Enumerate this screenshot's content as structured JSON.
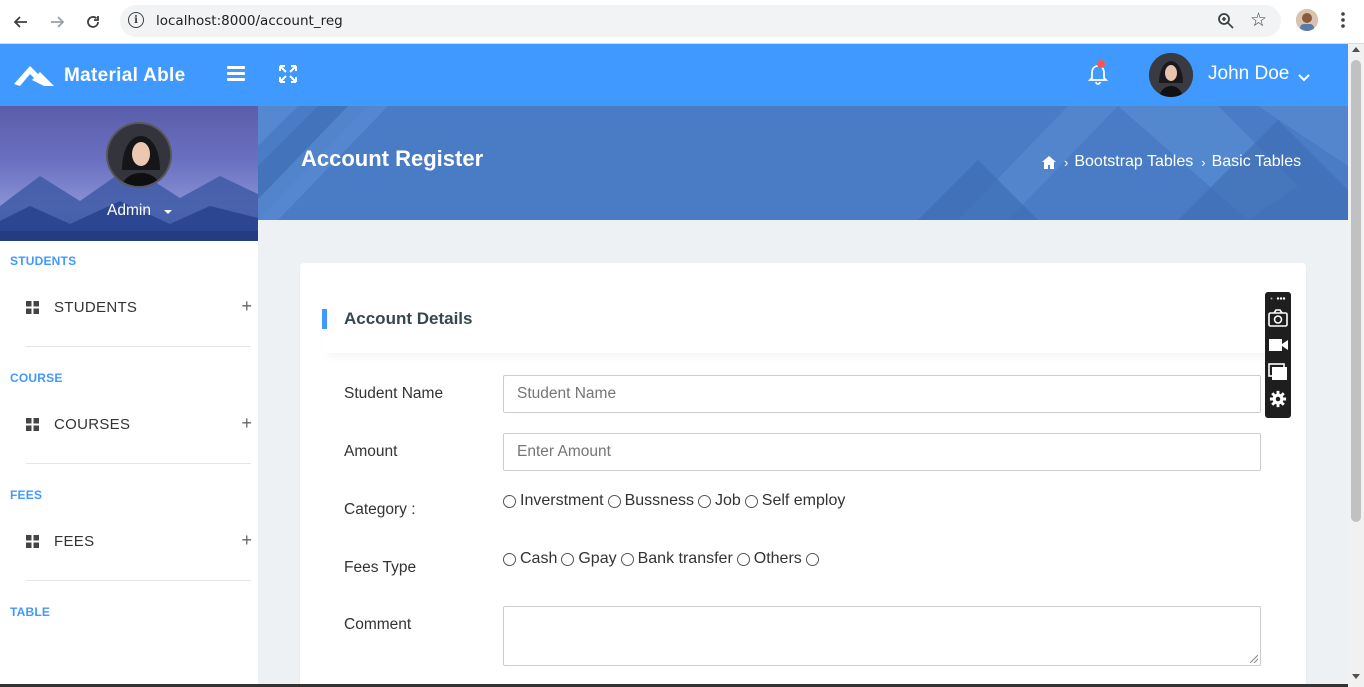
{
  "browser": {
    "url": "localhost:8000/account_reg"
  },
  "header": {
    "app_name": "Material Able",
    "user_name": "John Doe"
  },
  "sidebar": {
    "profile_name": "Admin",
    "sections": [
      {
        "heading": "STUDENTS",
        "item": "STUDENTS"
      },
      {
        "heading": "COURSE",
        "item": "COURSES"
      },
      {
        "heading": "FEES",
        "item": "FEES"
      },
      {
        "heading": "TABLE"
      }
    ]
  },
  "page": {
    "title": "Account Register",
    "breadcrumbs": [
      "Bootstrap Tables",
      "Basic Tables"
    ]
  },
  "form": {
    "card_title": "Account Details",
    "student_name_label": "Student Name",
    "student_name_placeholder": "Student Name",
    "amount_label": "Amount",
    "amount_placeholder": "Enter Amount",
    "category_label": "Category :",
    "category_options": [
      "Inverstment",
      "Bussness",
      "Job",
      "Self employ"
    ],
    "fees_type_label": "Fees Type",
    "fees_type_options": [
      "Cash",
      "Gpay",
      "Bank transfer",
      "Others"
    ],
    "comment_label": "Comment"
  },
  "colors": {
    "primary": "#4099ff",
    "banner": "#4a7cc5",
    "notification_dot": "#ff5252"
  },
  "icons": [
    "back-icon",
    "forward-icon",
    "reload-icon",
    "info-icon",
    "zoom-icon",
    "star-icon",
    "menu-icon",
    "expand-icon",
    "bell-icon",
    "caret-down-icon",
    "grid-icon",
    "plus-icon",
    "home-icon",
    "camera-icon",
    "video-icon",
    "window-icon",
    "gear-icon"
  ]
}
